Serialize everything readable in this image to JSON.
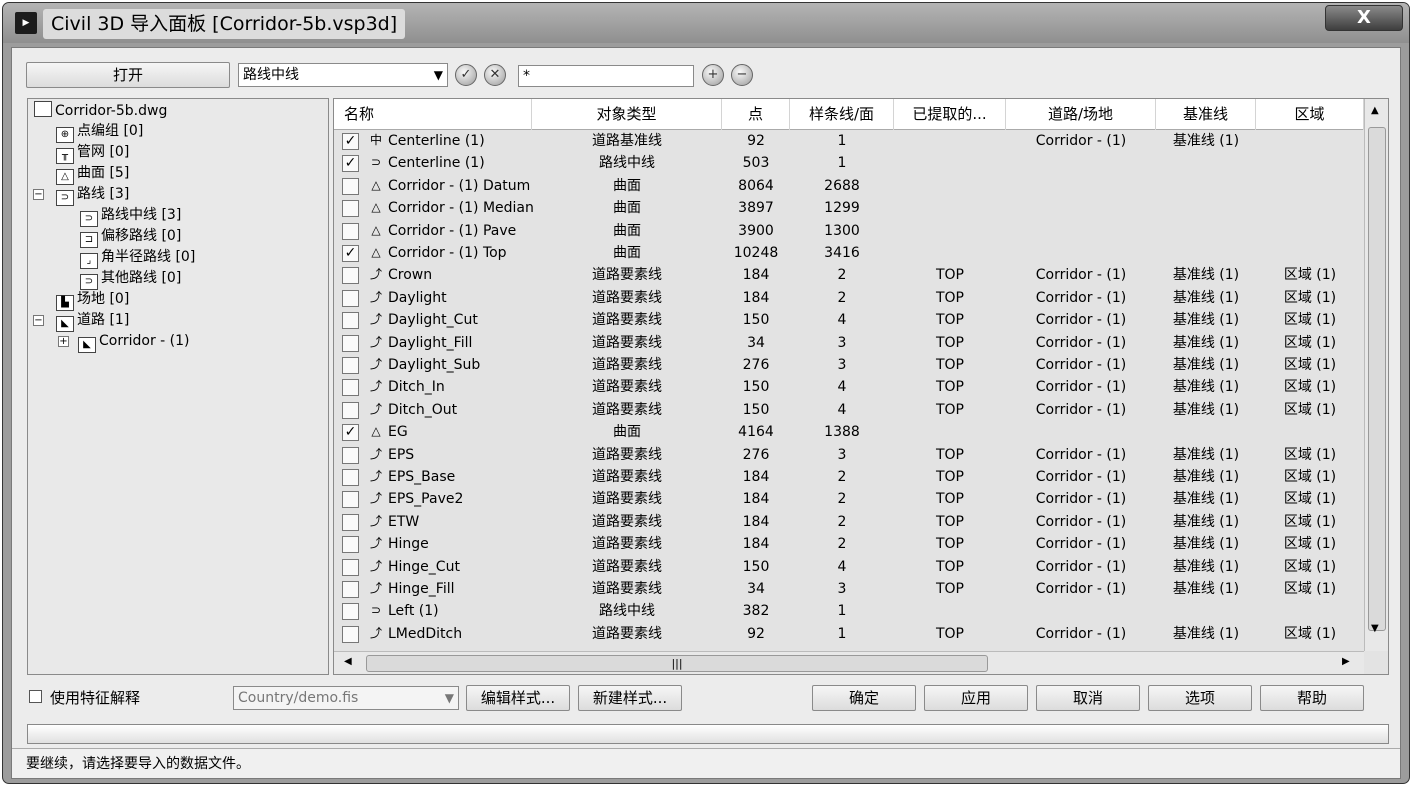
{
  "window": {
    "title": "Civil 3D 导入面板 [Corridor-5b.vsp3d]",
    "close_label": "X"
  },
  "toolbar": {
    "open_label": "打开",
    "filter_type": "路线中线",
    "filter_text": "*"
  },
  "tree": {
    "root": "Corridor-5b.dwg",
    "items": [
      "点编组 [0]",
      "管网 [0]",
      "曲面 [5]",
      "路线 [3]",
      "路线中线 [3]",
      "偏移路线 [0]",
      "角半径路线 [0]",
      "其他路线 [0]",
      "场地 [0]",
      "道路 [1]",
      "Corridor - (1)"
    ]
  },
  "grid": {
    "columns": [
      "名称",
      "对象类型",
      "点",
      "样条线/面",
      "已提取的...",
      "道路/场地",
      "基准线",
      "区域"
    ],
    "rows": [
      {
        "checked": true,
        "icon": "centerline-icon",
        "name": "Centerline (1)",
        "type": "道路基准线",
        "points": "92",
        "splines": "1",
        "extracted": "",
        "corridor": "Corridor - (1)",
        "baseline": "基准线 (1)",
        "region": ""
      },
      {
        "checked": true,
        "icon": "alignment-icon",
        "name": "Centerline (1)",
        "type": "路线中线",
        "points": "503",
        "splines": "1",
        "extracted": "",
        "corridor": "",
        "baseline": "",
        "region": ""
      },
      {
        "checked": false,
        "icon": "surface-icon",
        "name": "Corridor - (1) Datum",
        "type": "曲面",
        "points": "8064",
        "splines": "2688",
        "extracted": "",
        "corridor": "",
        "baseline": "",
        "region": ""
      },
      {
        "checked": false,
        "icon": "surface-icon",
        "name": "Corridor - (1) Median",
        "type": "曲面",
        "points": "3897",
        "splines": "1299",
        "extracted": "",
        "corridor": "",
        "baseline": "",
        "region": ""
      },
      {
        "checked": false,
        "icon": "surface-icon",
        "name": "Corridor - (1) Pave",
        "type": "曲面",
        "points": "3900",
        "splines": "1300",
        "extracted": "",
        "corridor": "",
        "baseline": "",
        "region": ""
      },
      {
        "checked": true,
        "icon": "surface-icon",
        "name": "Corridor - (1) Top",
        "type": "曲面",
        "points": "10248",
        "splines": "3416",
        "extracted": "",
        "corridor": "",
        "baseline": "",
        "region": ""
      },
      {
        "checked": false,
        "icon": "featureline-icon",
        "name": "Crown",
        "type": "道路要素线",
        "points": "184",
        "splines": "2",
        "extracted": "TOP",
        "corridor": "Corridor - (1)",
        "baseline": "基准线 (1)",
        "region": "区域 (1)"
      },
      {
        "checked": false,
        "icon": "featureline-icon",
        "name": "Daylight",
        "type": "道路要素线",
        "points": "184",
        "splines": "2",
        "extracted": "TOP",
        "corridor": "Corridor - (1)",
        "baseline": "基准线 (1)",
        "region": "区域 (1)"
      },
      {
        "checked": false,
        "icon": "featureline-icon",
        "name": "Daylight_Cut",
        "type": "道路要素线",
        "points": "150",
        "splines": "4",
        "extracted": "TOP",
        "corridor": "Corridor - (1)",
        "baseline": "基准线 (1)",
        "region": "区域 (1)"
      },
      {
        "checked": false,
        "icon": "featureline-icon",
        "name": "Daylight_Fill",
        "type": "道路要素线",
        "points": "34",
        "splines": "3",
        "extracted": "TOP",
        "corridor": "Corridor - (1)",
        "baseline": "基准线 (1)",
        "region": "区域 (1)"
      },
      {
        "checked": false,
        "icon": "featureline-icon",
        "name": "Daylight_Sub",
        "type": "道路要素线",
        "points": "276",
        "splines": "3",
        "extracted": "TOP",
        "corridor": "Corridor - (1)",
        "baseline": "基准线 (1)",
        "region": "区域 (1)"
      },
      {
        "checked": false,
        "icon": "featureline-icon",
        "name": "Ditch_In",
        "type": "道路要素线",
        "points": "150",
        "splines": "4",
        "extracted": "TOP",
        "corridor": "Corridor - (1)",
        "baseline": "基准线 (1)",
        "region": "区域 (1)"
      },
      {
        "checked": false,
        "icon": "featureline-icon",
        "name": "Ditch_Out",
        "type": "道路要素线",
        "points": "150",
        "splines": "4",
        "extracted": "TOP",
        "corridor": "Corridor - (1)",
        "baseline": "基准线 (1)",
        "region": "区域 (1)"
      },
      {
        "checked": true,
        "icon": "surface-icon",
        "name": "EG",
        "type": "曲面",
        "points": "4164",
        "splines": "1388",
        "extracted": "",
        "corridor": "",
        "baseline": "",
        "region": ""
      },
      {
        "checked": false,
        "icon": "featureline-icon",
        "name": "EPS",
        "type": "道路要素线",
        "points": "276",
        "splines": "3",
        "extracted": "TOP",
        "corridor": "Corridor - (1)",
        "baseline": "基准线 (1)",
        "region": "区域 (1)"
      },
      {
        "checked": false,
        "icon": "featureline-icon",
        "name": "EPS_Base",
        "type": "道路要素线",
        "points": "184",
        "splines": "2",
        "extracted": "TOP",
        "corridor": "Corridor - (1)",
        "baseline": "基准线 (1)",
        "region": "区域 (1)"
      },
      {
        "checked": false,
        "icon": "featureline-icon",
        "name": "EPS_Pave2",
        "type": "道路要素线",
        "points": "184",
        "splines": "2",
        "extracted": "TOP",
        "corridor": "Corridor - (1)",
        "baseline": "基准线 (1)",
        "region": "区域 (1)"
      },
      {
        "checked": false,
        "icon": "featureline-icon",
        "name": "ETW",
        "type": "道路要素线",
        "points": "184",
        "splines": "2",
        "extracted": "TOP",
        "corridor": "Corridor - (1)",
        "baseline": "基准线 (1)",
        "region": "区域 (1)"
      },
      {
        "checked": false,
        "icon": "featureline-icon",
        "name": "Hinge",
        "type": "道路要素线",
        "points": "184",
        "splines": "2",
        "extracted": "TOP",
        "corridor": "Corridor - (1)",
        "baseline": "基准线 (1)",
        "region": "区域 (1)"
      },
      {
        "checked": false,
        "icon": "featureline-icon",
        "name": "Hinge_Cut",
        "type": "道路要素线",
        "points": "150",
        "splines": "4",
        "extracted": "TOP",
        "corridor": "Corridor - (1)",
        "baseline": "基准线 (1)",
        "region": "区域 (1)"
      },
      {
        "checked": false,
        "icon": "featureline-icon",
        "name": "Hinge_Fill",
        "type": "道路要素线",
        "points": "34",
        "splines": "3",
        "extracted": "TOP",
        "corridor": "Corridor - (1)",
        "baseline": "基准线 (1)",
        "region": "区域 (1)"
      },
      {
        "checked": false,
        "icon": "alignment-icon",
        "name": "Left (1)",
        "type": "路线中线",
        "points": "382",
        "splines": "1",
        "extracted": "",
        "corridor": "",
        "baseline": "",
        "region": ""
      },
      {
        "checked": false,
        "icon": "featureline-icon",
        "name": "LMedDitch",
        "type": "道路要素线",
        "points": "92",
        "splines": "1",
        "extracted": "TOP",
        "corridor": "Corridor - (1)",
        "baseline": "基准线 (1)",
        "region": "区域 (1)"
      }
    ]
  },
  "bottom": {
    "feature_interpret_label": "使用特征解释",
    "style_file": "Country/demo.fis",
    "edit_style_label": "编辑样式...",
    "new_style_label": "新建样式...",
    "ok_label": "确定",
    "apply_label": "应用",
    "cancel_label": "取消",
    "options_label": "选项",
    "help_label": "帮助"
  },
  "status": "要继续，请选择要导入的数据文件。"
}
